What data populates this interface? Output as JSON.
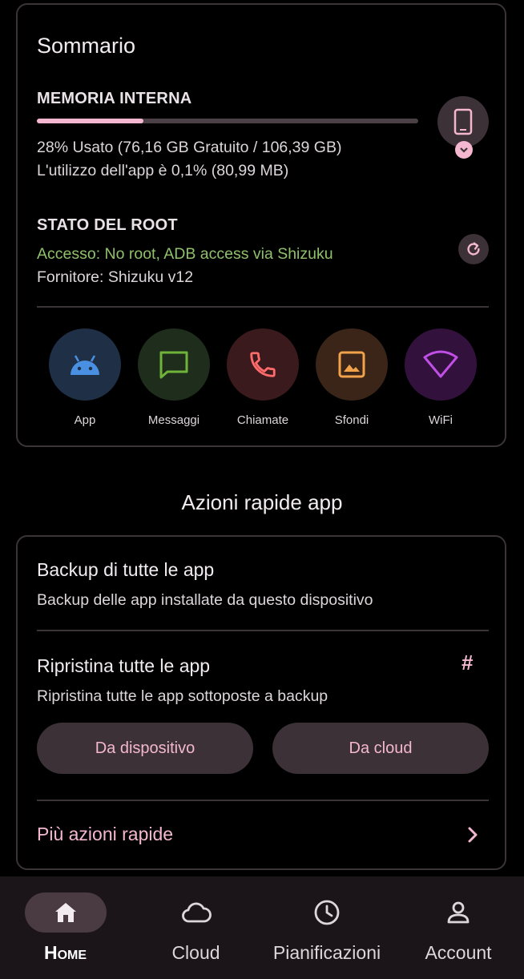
{
  "summary": {
    "title": "Sommario",
    "storage": {
      "label": "MEMORIA INTERNA",
      "used_fraction": 0.28,
      "usage_text": "28% Usato (76,16 GB Gratuito / 106,39 GB)",
      "app_usage_text": "L'utilizzo dell'app è 0,1% (80,99 MB)"
    },
    "root": {
      "label": "STATO DEL ROOT",
      "access_text": "Accesso: No root, ADB access via Shizuku",
      "provider_text": "Fornitore: Shizuku v12"
    },
    "shortcuts": [
      {
        "label": "App",
        "icon": "android-icon",
        "bg": "#1f2f45",
        "fg": "#4a90e2"
      },
      {
        "label": "Messaggi",
        "icon": "message-icon",
        "bg": "#1f2d1c",
        "fg": "#6fb33a"
      },
      {
        "label": "Chiamate",
        "icon": "phone-call-icon",
        "bg": "#3a1a1d",
        "fg": "#ff6b6b"
      },
      {
        "label": "Sfondi",
        "icon": "image-icon",
        "bg": "#3a2518",
        "fg": "#f2a24a"
      },
      {
        "label": "WiFi",
        "icon": "wifi-icon",
        "bg": "#33113d",
        "fg": "#c04fe6"
      }
    ]
  },
  "quick_actions": {
    "heading": "Azioni rapide app",
    "backup_title": "Backup di tutte le app",
    "backup_subtitle": "Backup delle app installate da questo dispositivo",
    "restore_title": "Ripristina tutte le app",
    "restore_subtitle": "Ripristina tutte le app sottoposte a backup",
    "restore_icon": "#",
    "from_device_label": "Da dispositivo",
    "from_cloud_label": "Da cloud",
    "more_label": "Più azioni rapide"
  },
  "bottom_nav": [
    {
      "label": "Home",
      "icon": "home-icon",
      "active": true
    },
    {
      "label": "Cloud",
      "icon": "cloud-icon",
      "active": false
    },
    {
      "label": "Pianificazioni",
      "icon": "clock-icon",
      "active": false
    },
    {
      "label": "Account",
      "icon": "account-icon",
      "active": false
    }
  ],
  "colors": {
    "accent": "#f4b7cf",
    "root_status": "#8fc06a",
    "background": "#000000",
    "surface": "#3b3136"
  }
}
